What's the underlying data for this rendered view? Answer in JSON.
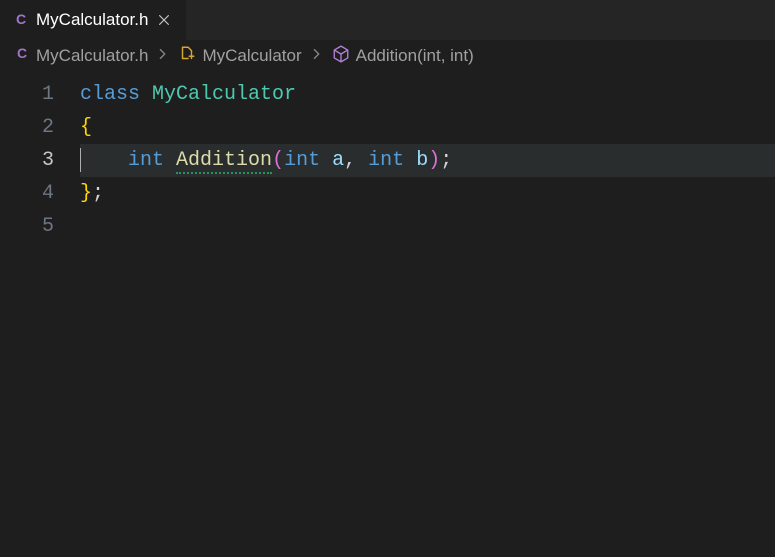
{
  "tab": {
    "icon_letter": "C",
    "label": "MyCalculator.h"
  },
  "breadcrumb": {
    "file_icon_letter": "C",
    "file": "MyCalculator.h",
    "class_name": "MyCalculator",
    "method": "Addition(int, int)"
  },
  "gutter": {
    "lines": [
      "1",
      "2",
      "3",
      "4",
      "5"
    ],
    "active_index": 2
  },
  "code": {
    "l1": {
      "kw": "class",
      "type": "MyCalculator"
    },
    "l2": {
      "brace": "{"
    },
    "l3": {
      "indent": "    ",
      "ret": "int",
      "fn": "Addition",
      "open": "(",
      "p1t": "int",
      "p1n": "a",
      "comma": ",",
      "p2t": "int",
      "p2n": "b",
      "close": ")",
      "semi": ";"
    },
    "l4": {
      "brace": "}",
      "semi": ";"
    }
  }
}
